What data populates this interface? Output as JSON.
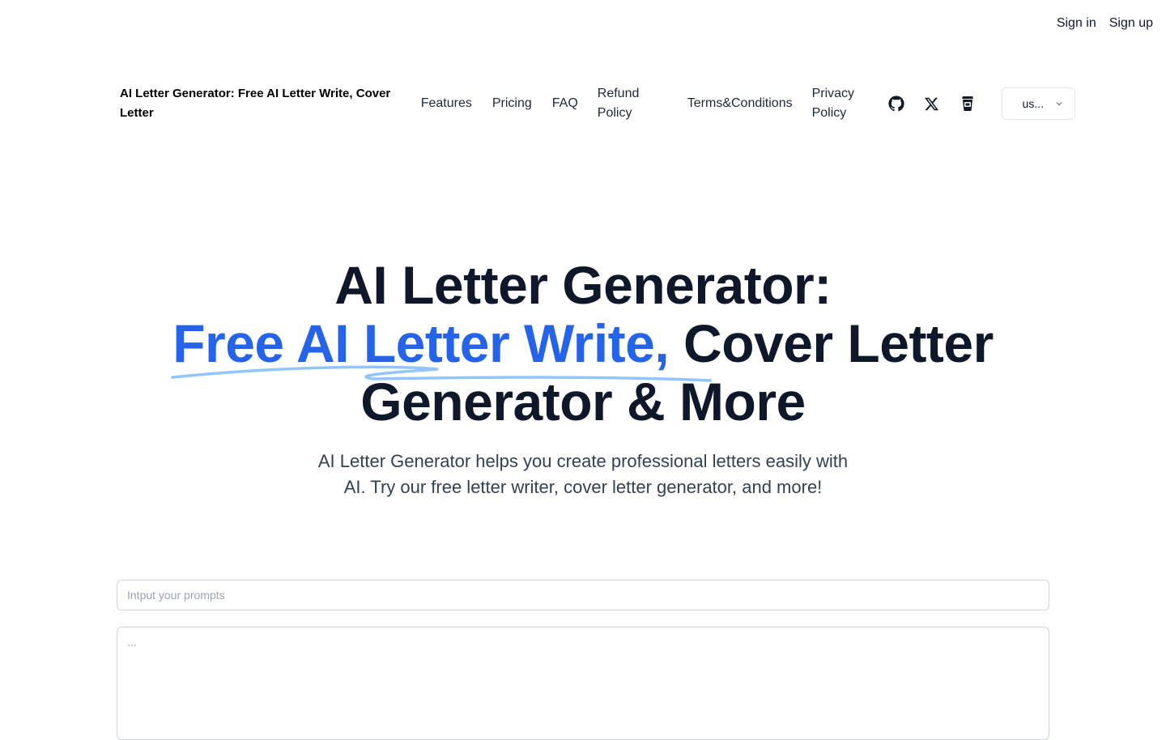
{
  "auth": {
    "sign_in": "Sign in",
    "sign_up": "Sign up"
  },
  "nav": {
    "brand": "AI Letter Generator: Free AI Letter Write, Cover Letter",
    "links": [
      "Features",
      "Pricing",
      "FAQ",
      "Refund Policy",
      "Terms&Conditions",
      "Privacy Policy"
    ],
    "icons": [
      "github-icon",
      "x-icon",
      "coffee-icon"
    ],
    "locale": "us..."
  },
  "hero": {
    "line1": "AI Letter Generator:",
    "accent": "Free AI Letter Write,",
    "line2_rest": " Cover Letter",
    "line3": "Generator & More",
    "subtitle": "AI Letter Generator helps you create professional letters easily with AI. Try our free letter writer, cover letter generator, and more!"
  },
  "form": {
    "prompt_placeholder": "Intput your prompts",
    "output_placeholder": "..."
  },
  "colors": {
    "accent": "#2563eb",
    "text": "#0f172a",
    "underline": "#93c5fd"
  }
}
